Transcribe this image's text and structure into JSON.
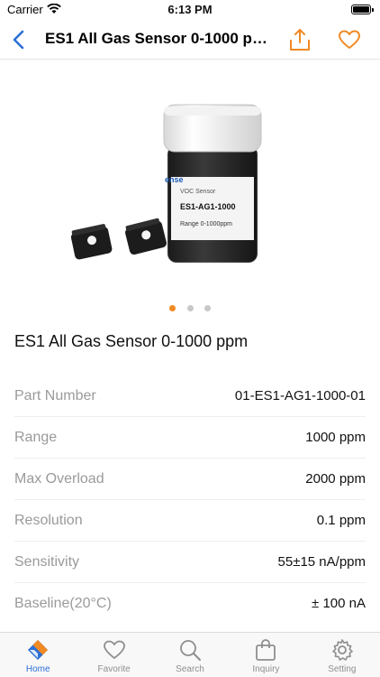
{
  "status_bar": {
    "carrier": "Carrier",
    "time": "6:13 PM"
  },
  "nav": {
    "title": "ES1 All Gas Sensor 0-1000 pp..."
  },
  "product": {
    "title": "ES1 All Gas Sensor 0-1000 ppm",
    "image": {
      "label_brand": "ense",
      "label_type": "VOC Sensor",
      "label_model": "ES1-AG1-1000",
      "label_range": "Range 0-1000ppm"
    },
    "carousel": {
      "current": 1,
      "total": 3
    }
  },
  "specs": [
    {
      "label": "Part Number",
      "value": "01-ES1-AG1-1000-01"
    },
    {
      "label": "Range",
      "value": "1000 ppm"
    },
    {
      "label": "Max Overload",
      "value": "2000 ppm"
    },
    {
      "label": "Resolution",
      "value": "0.1 ppm"
    },
    {
      "label": "Sensitivity",
      "value": "55±15 nA/ppm"
    },
    {
      "label": "Baseline(20°C)",
      "value": "± 100 nA"
    }
  ],
  "tabbar": {
    "active": "Home",
    "tabs": [
      {
        "label": "Home",
        "icon": "home-logo-icon"
      },
      {
        "label": "Favorite",
        "icon": "heart-icon"
      },
      {
        "label": "Search",
        "icon": "search-icon"
      },
      {
        "label": "Inquiry",
        "icon": "bag-icon"
      },
      {
        "label": "Setting",
        "icon": "gear-icon"
      }
    ]
  },
  "colors": {
    "accent_blue": "#2b6fd6",
    "accent_orange": "#f08a24"
  }
}
